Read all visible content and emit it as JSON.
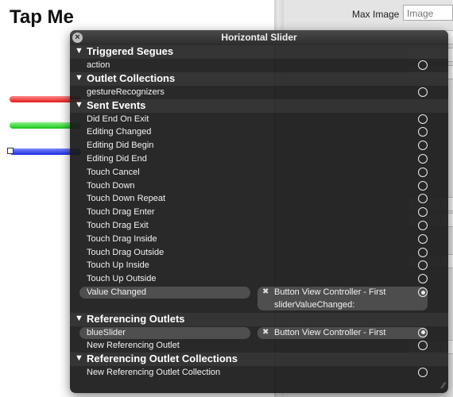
{
  "canvas": {
    "title": "Tap Me"
  },
  "inspector": {
    "max_image_label": "Max Image",
    "max_image_placeholder": "Image"
  },
  "hud": {
    "title": "Horizontal Slider",
    "sections": [
      {
        "title": "Triggered Segues",
        "rows": [
          {
            "label": "action",
            "connected": false
          }
        ]
      },
      {
        "title": "Outlet Collections",
        "rows": [
          {
            "label": "gestureRecognizers",
            "connected": false
          }
        ]
      },
      {
        "title": "Sent Events",
        "rows": [
          {
            "label": "Did End On Exit",
            "connected": false
          },
          {
            "label": "Editing Changed",
            "connected": false
          },
          {
            "label": "Editing Did Begin",
            "connected": false
          },
          {
            "label": "Editing Did End",
            "connected": false
          },
          {
            "label": "Touch Cancel",
            "connected": false
          },
          {
            "label": "Touch Down",
            "connected": false
          },
          {
            "label": "Touch Down Repeat",
            "connected": false
          },
          {
            "label": "Touch Drag Enter",
            "connected": false
          },
          {
            "label": "Touch Drag Exit",
            "connected": false
          },
          {
            "label": "Touch Drag Inside",
            "connected": false
          },
          {
            "label": "Touch Drag Outside",
            "connected": false
          },
          {
            "label": "Touch Up Inside",
            "connected": false
          },
          {
            "label": "Touch Up Outside",
            "connected": false
          },
          {
            "label": "Value Changed",
            "connected": true,
            "target_line1": "Button View Controller - First",
            "target_line2": "sliderValueChanged:"
          }
        ]
      },
      {
        "title": "Referencing Outlets",
        "rows": [
          {
            "label": "blueSlider",
            "connected": true,
            "target_line1": "Button View Controller - First"
          },
          {
            "label": "New Referencing Outlet",
            "connected": false
          }
        ]
      },
      {
        "title": "Referencing Outlet Collections",
        "rows": [
          {
            "label": "New Referencing Outlet Collection",
            "connected": false
          }
        ]
      }
    ]
  },
  "icons": {
    "close": "close-icon",
    "section_toggle": "disclosure-triangle-icon",
    "connection": "connection-circle-icon",
    "remove": "remove-connection-icon",
    "resize": "resize-grip-icon"
  }
}
